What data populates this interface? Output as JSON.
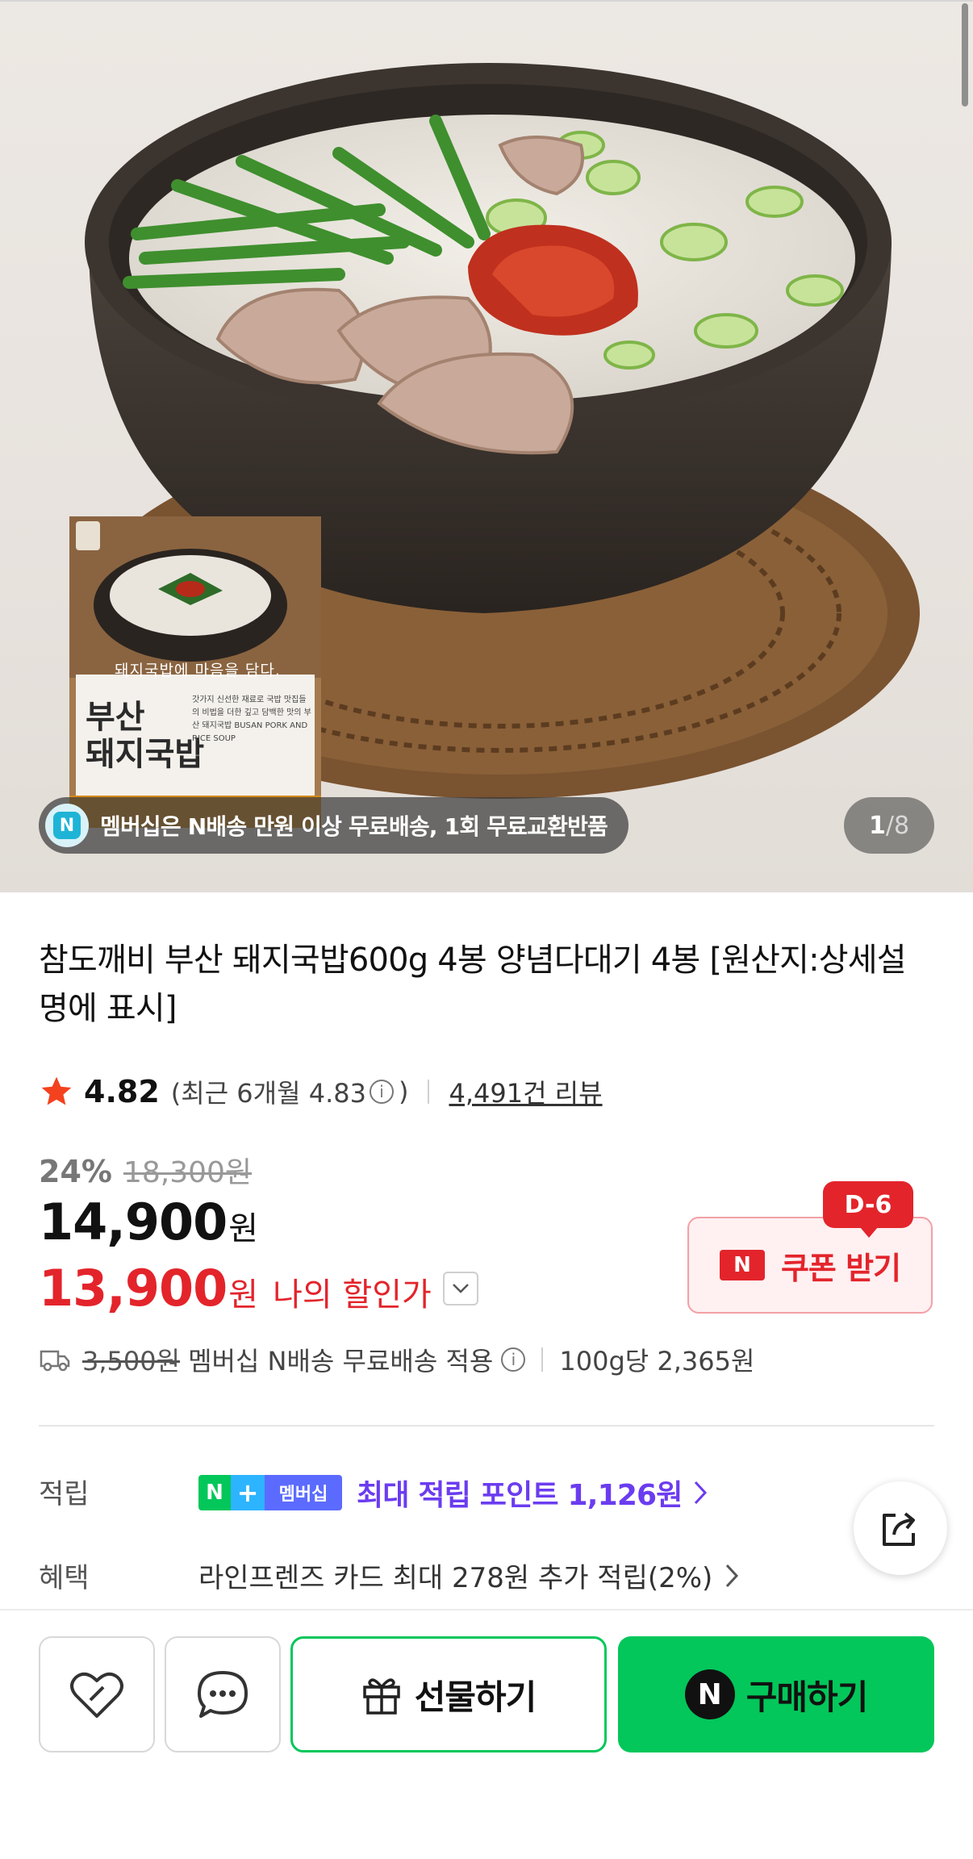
{
  "hero": {
    "member_banner": "멤버십은 N배송 만원 이상 무료배송, 1회 무료교환반품",
    "member_logo": "N",
    "counter_current": "1",
    "counter_sep": "/",
    "counter_total": "8",
    "package": {
      "tagline": "돼지국밥에 마음을 담다.",
      "name": "부산\n돼지국밥",
      "desc": "갓가지 신선한 재료로 국밥 맛집들의 비법을 더한 깊고 담백한 맛의 부산 돼지국밥 BUSAN PORK AND RICE SOUP"
    }
  },
  "product": {
    "title": "참도깨비 부산 돼지국밥600g 4봉 양념다대기 4봉 [원산지:상세설명에 표시]",
    "rating": "4.82",
    "recent_rating": "(최근 6개월 4.83",
    "recent_close": ")",
    "info_glyph": "i",
    "reviews": "4,491건 리뷰",
    "discount_rate": "24%",
    "original_price": "18,300원",
    "price": "14,900",
    "won": "원",
    "my_price": "13,900",
    "my_price_label": "나의 할인가",
    "coupon_badge": "N",
    "coupon_label": "쿠폰 받기",
    "coupon_dday": "D-6",
    "shipping_original": "3,500원",
    "shipping_text": "멤버십 N배송 무료배송 적용",
    "unit_price": "100g당 2,365원"
  },
  "points": {
    "label": "적립",
    "badge_n": "N",
    "badge_plus": "+",
    "badge_member": "멤버십",
    "text": "최대 적립 포인트 1,126원"
  },
  "benefit": {
    "label": "혜택",
    "text": "라인프렌즈 카드 최대 278원 추가 적립(2%)"
  },
  "actions": {
    "gift": "선물하기",
    "buy": "구매하기",
    "buy_logo": "N"
  },
  "icons": {
    "wishlist": "heart-outline-icon",
    "talk": "chat-bubble-icon",
    "gift": "gift-box-icon",
    "share": "share-icon",
    "shipping": "truck-icon",
    "star": "star-icon"
  },
  "colors": {
    "accent_red": "#e3242b",
    "naver_green": "#03c75a",
    "points_purple": "#6b3cf0"
  }
}
